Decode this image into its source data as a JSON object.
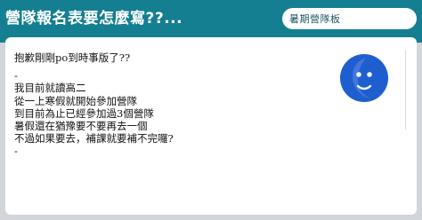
{
  "header": {
    "title": "營隊報名表要怎麼寫??...",
    "board_label": "暑期營隊板"
  },
  "post": {
    "lines": [
      "抱歉剛剛po到時事版了??",
      "-",
      "我目前就讀高二",
      "從一上寒假就開始參加營隊",
      "到目前為止已經參加過3個營隊",
      "暑假還在猶豫要不要再去一個",
      "不過如果要去，補課就要補不完囉?",
      "-"
    ]
  },
  "avatar": {
    "icon": "moon-face-icon",
    "color": "#1f5ecf"
  },
  "colors": {
    "header_bg": "#147f90",
    "page_bg": "#d2d5da"
  }
}
